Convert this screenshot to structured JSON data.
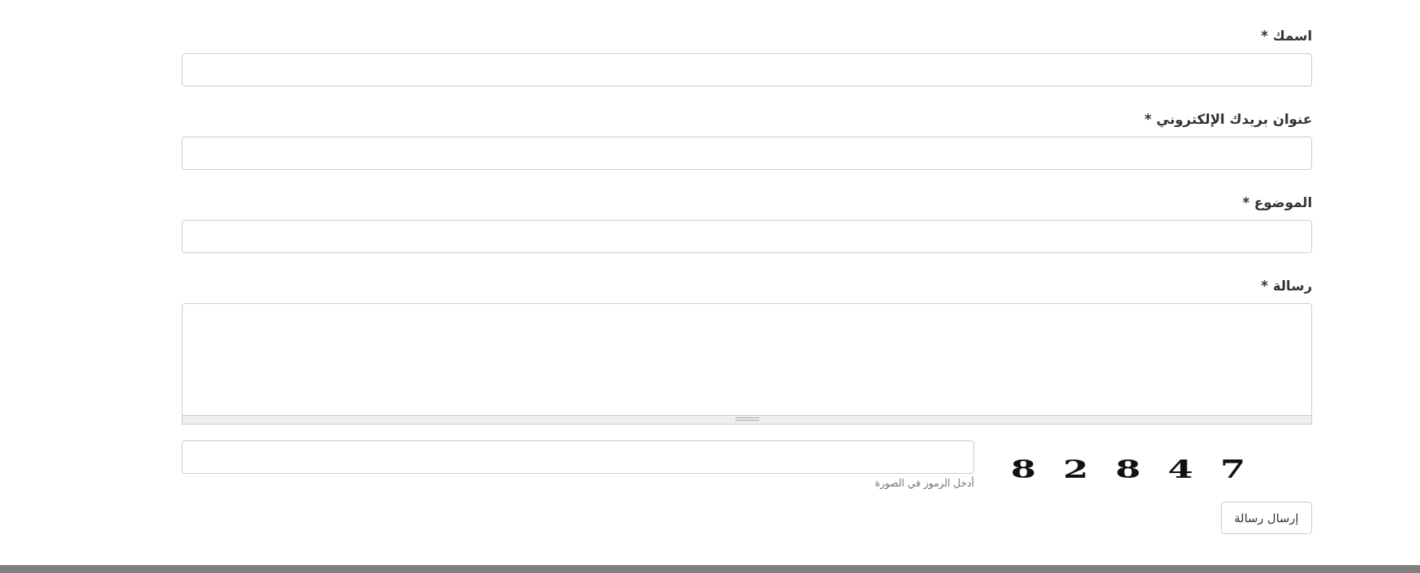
{
  "fields": [
    {
      "kind": "input",
      "label": "اسمك *"
    },
    {
      "kind": "input",
      "label": "عنوان بريدك الإلكتروني *"
    },
    {
      "kind": "input",
      "label": "الموضوع *"
    },
    {
      "kind": "textarea",
      "label": "رسالة *"
    }
  ],
  "captcha": {
    "hint": "أدخل الرموز في الصورة",
    "code": "82847"
  },
  "submit_button": "إرسال رسالة"
}
